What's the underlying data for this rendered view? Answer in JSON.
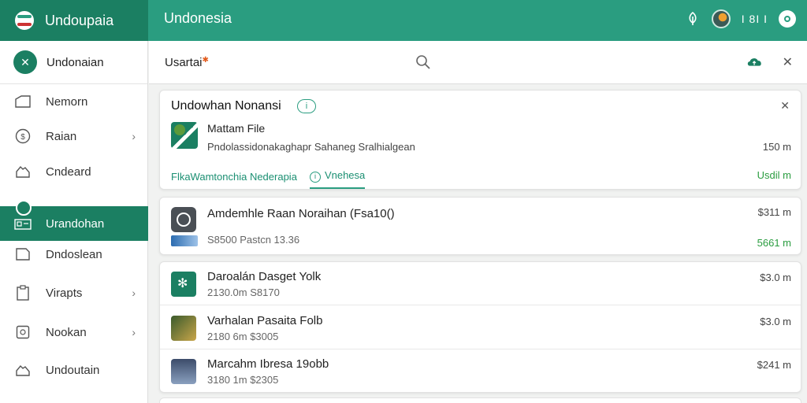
{
  "app": {
    "brand_name": "Undoupaia",
    "title": "Undonesia"
  },
  "topbar": {
    "status_text": "I 8I I",
    "icons": [
      "leaf-icon",
      "avatar",
      "settings-icon"
    ]
  },
  "sidebar": {
    "header_label": "Undonaian",
    "items": [
      {
        "label": "Nemorn",
        "icon": "folder-icon",
        "chevron": false
      },
      {
        "label": "Raian",
        "icon": "clock-icon",
        "chevron": true
      },
      {
        "label": "Cndeard",
        "icon": "cloud-icon",
        "chevron": false
      },
      {
        "label": "Urandohan",
        "icon": "grid-icon",
        "chevron": false,
        "active": true
      },
      {
        "label": "Dndoslean",
        "icon": "square-icon",
        "chevron": false
      },
      {
        "label": "Virapts",
        "icon": "clipboard-icon",
        "chevron": true
      },
      {
        "label": "Nookan",
        "icon": "box-icon",
        "chevron": true
      },
      {
        "label": "Undoutain",
        "icon": "cloud-icon",
        "chevron": false
      }
    ]
  },
  "searchbar": {
    "label": "Usartai",
    "spark": "✱"
  },
  "card1": {
    "title": "Undowhan Nonansi",
    "file_name": "Mattam File",
    "description": "Pndolassidonakaghapr  Sahaneg Sralhialgean",
    "size": "150 m",
    "tabs": [
      {
        "label": "FlkaWamtonchia Nederapia",
        "active": false
      },
      {
        "label": "Vnehesa",
        "active": true
      }
    ],
    "meta": "Usdil m"
  },
  "card2": {
    "title": "Amdemhle Raan Noraihan (Fsa10()",
    "sub": "S8500 Pastcn 13.36",
    "amount": "$311 m",
    "amount2": "5661 m"
  },
  "list": [
    {
      "title": "Daroalán Dasget Yolk",
      "sub": "2130.0m S8170",
      "amount": "$3.0 m",
      "thumb": "green"
    },
    {
      "title": "Varhalan Pasaita Folb",
      "sub": "2180 6m $3005",
      "amount": "$3.0 m",
      "thumb": "book"
    },
    {
      "title": "Marcahm Ibresa 19obb",
      "sub": "3180 1m $2305",
      "amount": "$241 m",
      "thumb": "photo"
    }
  ],
  "colors": {
    "brand": "#1b7f62",
    "topbar": "#2a9d80",
    "positive": "#2a9d40"
  }
}
